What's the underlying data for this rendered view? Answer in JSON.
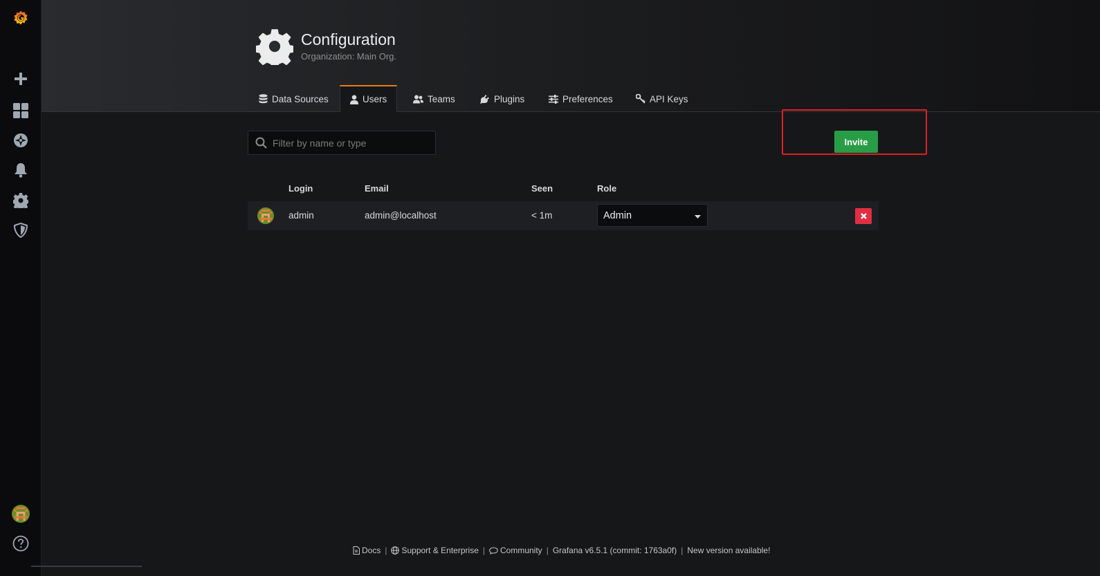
{
  "header": {
    "title": "Configuration",
    "subtitle": "Organization: Main Org."
  },
  "tabs": [
    {
      "label": "Data Sources",
      "icon": "database-icon",
      "active": false
    },
    {
      "label": "Users",
      "icon": "user-icon",
      "active": true
    },
    {
      "label": "Teams",
      "icon": "users-icon",
      "active": false
    },
    {
      "label": "Plugins",
      "icon": "plug-icon",
      "active": false
    },
    {
      "label": "Preferences",
      "icon": "sliders-icon",
      "active": false
    },
    {
      "label": "API Keys",
      "icon": "key-icon",
      "active": false
    }
  ],
  "filter": {
    "placeholder": "Filter by name or type"
  },
  "invite_label": "Invite",
  "table": {
    "headers": {
      "login": "Login",
      "email": "Email",
      "seen": "Seen",
      "role": "Role"
    },
    "rows": [
      {
        "login": "admin",
        "email": "admin@localhost",
        "seen": "< 1m",
        "role": "Admin"
      }
    ]
  },
  "footer": {
    "docs": "Docs",
    "support": "Support & Enterprise",
    "community": "Community",
    "version": "Grafana v6.5.1 (commit: 1763a0f)",
    "new_version": "New version available!"
  },
  "colors": {
    "accent": "#eb7b18",
    "invite_green": "#299c46",
    "danger": "#e02f44",
    "highlight": "#e02020"
  }
}
